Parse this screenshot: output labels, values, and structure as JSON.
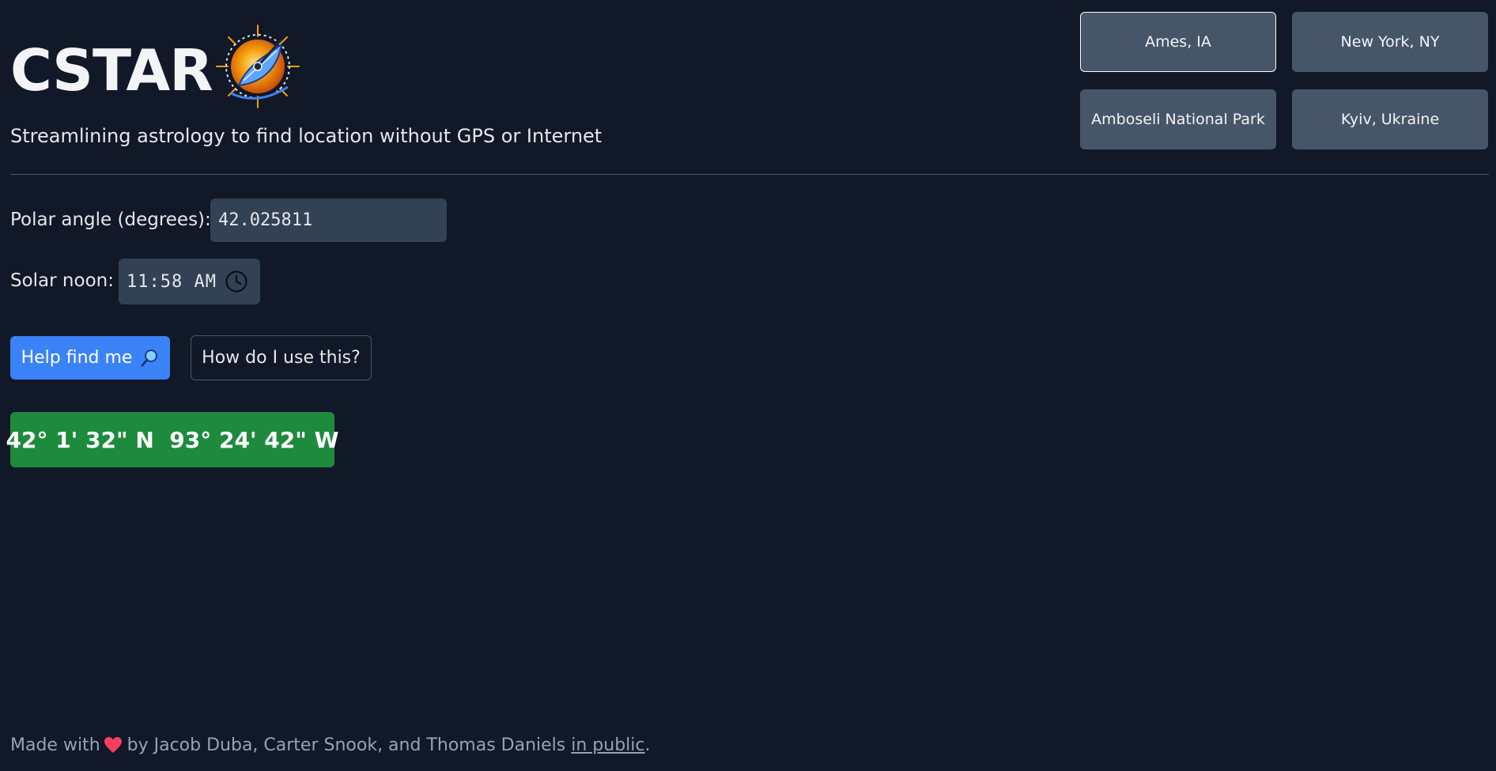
{
  "header": {
    "title": "CSTAR",
    "subtitle": "Streamlining astrology to find location without GPS or Internet"
  },
  "presets": [
    {
      "label": "Ames, IA",
      "selected": true
    },
    {
      "label": "New York, NY",
      "selected": false
    },
    {
      "label": "Amboseli National Park",
      "selected": false
    },
    {
      "label": "Kyiv, Ukraine",
      "selected": false
    }
  ],
  "form": {
    "polar_angle_label": "Polar angle (degrees):",
    "polar_angle_value": "42.025811",
    "solar_noon_label": "Solar noon:",
    "solar_noon_value": "11:58 AM"
  },
  "actions": {
    "help_label": "Help find me",
    "how_label": "How do I use this?"
  },
  "result": {
    "coordinates": "42° 1' 32\" N  93° 24' 42\" W"
  },
  "footer": {
    "made_with": "Made with",
    "by": "by Jacob Duba, Carter Snook, and Thomas Daniels",
    "link": "in public",
    "end": "."
  },
  "colors": {
    "background": "#111827",
    "preset_button": "#475569",
    "input_bg": "#334155",
    "primary": "#3b82f6",
    "success": "#1e8a3e",
    "heart": "#f43f5e"
  },
  "icons": {
    "logo": "compass-sun-logo",
    "clock": "clock-icon",
    "search": "magnifier-icon",
    "heart": "heart-icon"
  }
}
